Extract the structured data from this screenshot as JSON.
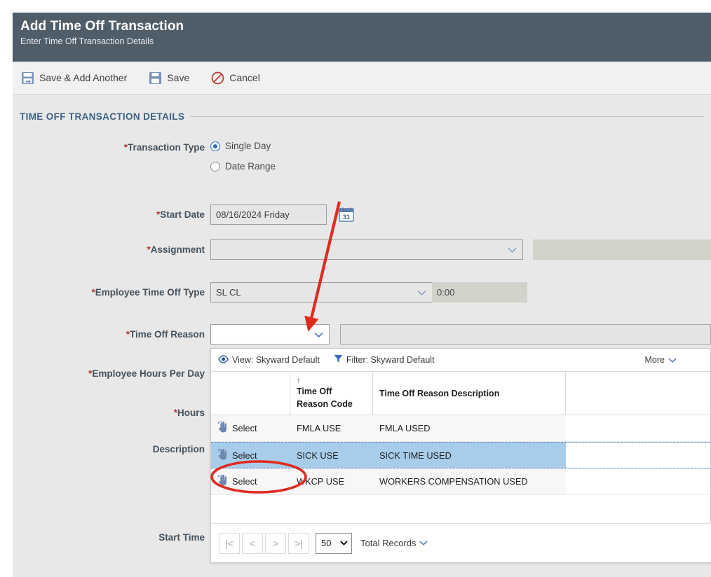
{
  "header": {
    "title": "Add Time Off Transaction",
    "subtitle": "Enter Time Off Transaction Details",
    "bg_color": "#4f5d68"
  },
  "toolbar": {
    "save_add_another_label": "Save & Add Another",
    "save_label": "Save",
    "cancel_label": "Cancel"
  },
  "section": {
    "title": "TIME OFF TRANSACTION DETAILS",
    "title_color": "#3c6286"
  },
  "form": {
    "transaction_type": {
      "label": "*Transaction Type",
      "options": [
        {
          "label": "Single Day",
          "selected": true
        },
        {
          "label": "Date Range",
          "selected": false
        }
      ]
    },
    "start_date": {
      "label": "*Start Date",
      "value": "08/16/2024 Friday",
      "calendar_icon_day": "31"
    },
    "assignment": {
      "label": "*Assignment",
      "value": "",
      "secondary_value": ""
    },
    "employee_time_off_type": {
      "label": "*Employee Time Off Type",
      "value": "SL CL",
      "balance_value": "0:00"
    },
    "time_off_reason": {
      "label": "*Time Off Reason",
      "value": "",
      "description_value": ""
    },
    "employee_hours_per_day": {
      "label": "*Employee Hours Per Day",
      "value": ""
    },
    "hours": {
      "label": "*Hours",
      "value": ""
    },
    "description": {
      "label": "Description",
      "value": ""
    },
    "start_time": {
      "label": "Start Time",
      "value": ""
    }
  },
  "dropdown_panel": {
    "view_label": "View: Skyward Default",
    "filter_label": "Filter: Skyward Default",
    "more_label": "More",
    "columns": [
      {
        "key": "select",
        "label": ""
      },
      {
        "key": "code",
        "label": "Time Off\nReason Code",
        "sorted": true,
        "sort_dir": "asc"
      },
      {
        "key": "desc",
        "label": "Time Off Reason Description"
      }
    ],
    "column_headers": {
      "select": "",
      "code_line1": "Time Off",
      "code_line2": "Reason Code",
      "description": "Time Off Reason Description"
    },
    "select_action_label": "Select",
    "rows": [
      {
        "code": "FMLA USE",
        "description": "FMLA USED",
        "selected": false
      },
      {
        "code": "SICK USE",
        "description": "SICK TIME USED",
        "selected": true
      },
      {
        "code": "WKCP USE",
        "description": "WORKERS COMPENSATION USED",
        "selected": false
      }
    ],
    "selected_row_color": "#a8cdeb",
    "pager": {
      "first_label": "|<",
      "prev_label": "<",
      "next_label": ">",
      "last_label": ">|",
      "page_size": "50",
      "total_records_label": "Total Records"
    }
  },
  "annotations": {
    "arrow_color": "#e02b20",
    "ellipse_color": "#e02b20"
  }
}
